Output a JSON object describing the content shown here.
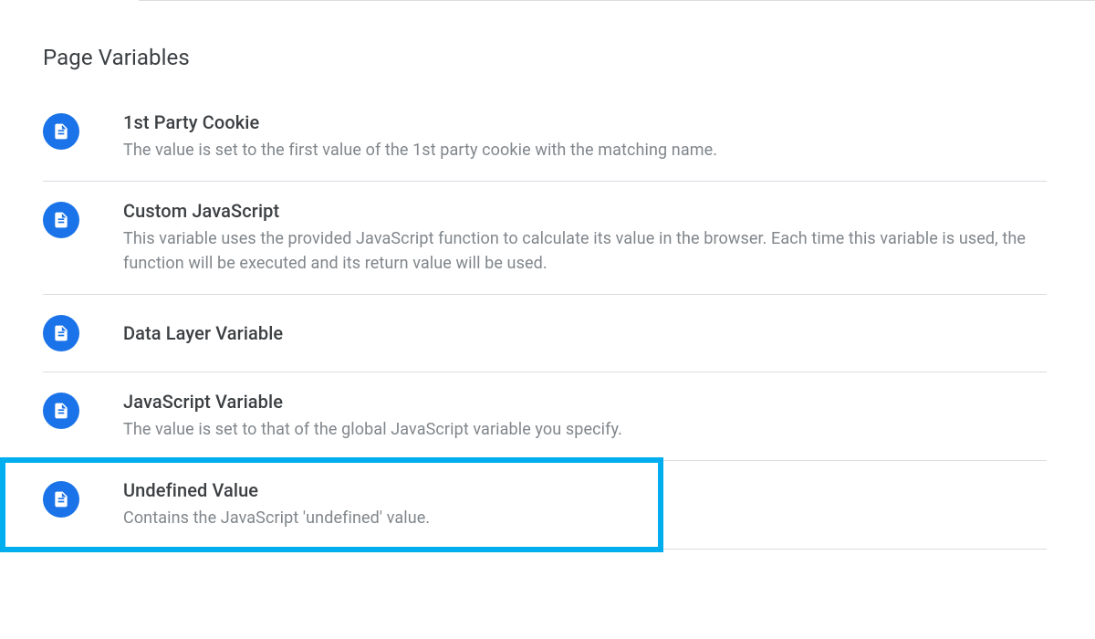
{
  "section": {
    "title": "Page Variables"
  },
  "variables": [
    {
      "title": "1st Party Cookie",
      "description": "The value is set to the first value of the 1st party cookie with the matching name."
    },
    {
      "title": "Custom JavaScript",
      "description": "This variable uses the provided JavaScript function to calculate its value in the browser. Each time this variable is used, the function will be executed and its return value will be used."
    },
    {
      "title": "Data Layer Variable",
      "description": ""
    },
    {
      "title": "JavaScript Variable",
      "description": "The value is set to that of the global JavaScript variable you specify."
    },
    {
      "title": "Undefined Value",
      "description": "Contains the JavaScript 'undefined' value."
    }
  ]
}
